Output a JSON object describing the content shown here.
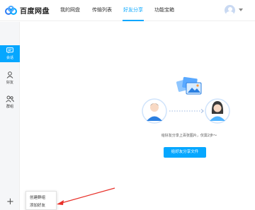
{
  "app": {
    "name": "百度网盘",
    "accent": "#06a7ff",
    "logo_icon": "baidu-cloud-logo-icon"
  },
  "header": {
    "tabs": [
      {
        "label": "我的网盘",
        "active": false
      },
      {
        "label": "传输列表",
        "active": false
      },
      {
        "label": "好友分享",
        "active": true
      },
      {
        "label": "功能宝箱",
        "active": false
      }
    ],
    "avatar_icon": "user-avatar-icon",
    "menu_icon": "caret-down-icon"
  },
  "sidebar": {
    "items": [
      {
        "label": "会话",
        "icon": "chat-icon",
        "active": true
      },
      {
        "label": "好友",
        "icon": "person-icon",
        "active": false
      },
      {
        "label": "群组",
        "icon": "group-icon",
        "active": false
      }
    ],
    "add_icon": "plus-icon"
  },
  "popup_menu": {
    "items": [
      {
        "label": "创建群组"
      },
      {
        "label": "添加好友"
      }
    ]
  },
  "main": {
    "caption": "给好友分享上百张图片，仅需2步～",
    "button_label": "给好友分享文件"
  }
}
